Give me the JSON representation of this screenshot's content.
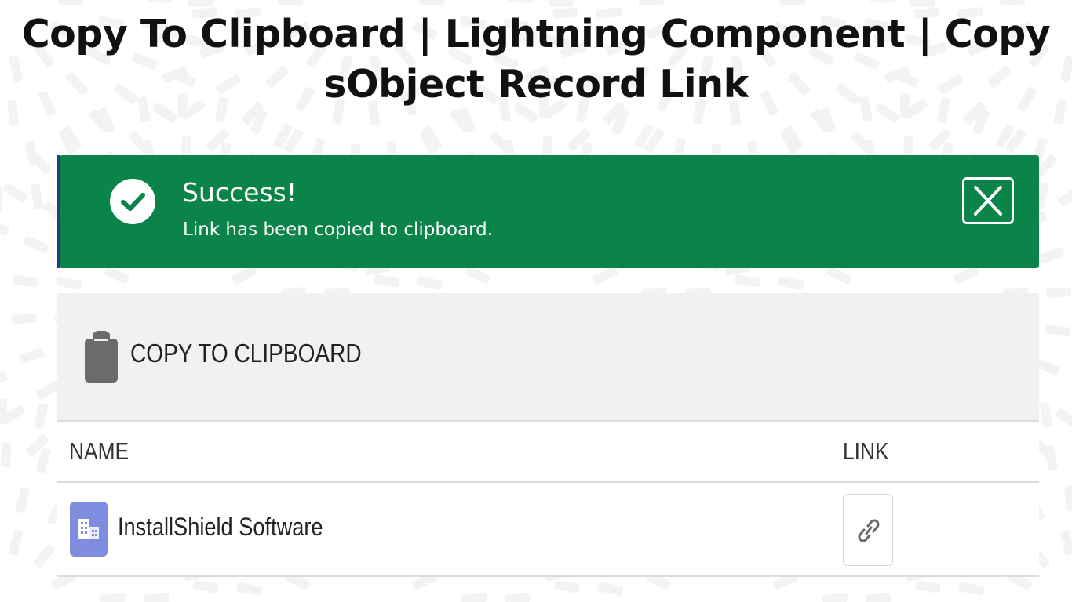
{
  "page": {
    "title": "Copy To Clipboard | Lightning Component | Copy sObject Record Link"
  },
  "toast": {
    "heading": "Success!",
    "message": "Link has been copied to clipboard.",
    "icon": "check-circle-icon",
    "close_icon": "close-icon",
    "color": "#0b844a"
  },
  "card": {
    "title": "COPY TO CLIPBOARD",
    "icon": "clipboard-icon",
    "columns": [
      "NAME",
      "LINK"
    ],
    "rows": [
      {
        "name": "InstallShield Software",
        "icon": "account-icon",
        "link_icon": "link-icon"
      }
    ]
  }
}
